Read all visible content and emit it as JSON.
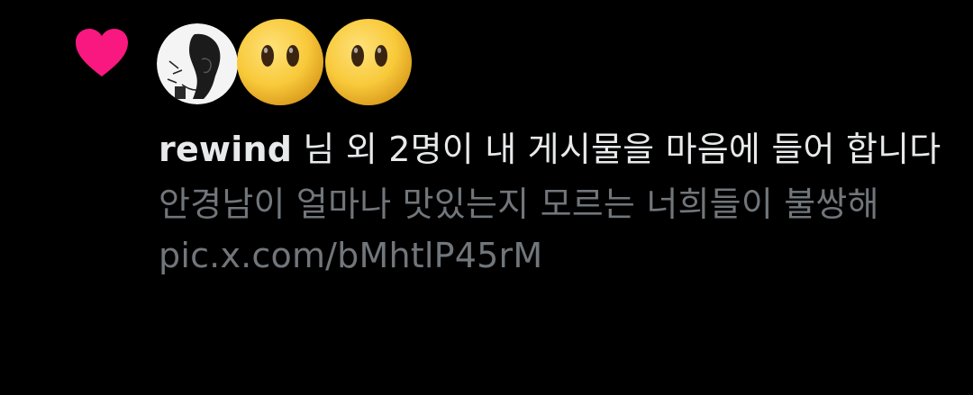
{
  "notification": {
    "type_icon": "heart-icon",
    "colors": {
      "heart": "#f91880",
      "primary_text": "#e7e9ea",
      "secondary_text": "#71767b",
      "background": "#000000"
    },
    "avatars": [
      {
        "icon": "user-sketch-avatar"
      },
      {
        "icon": "emoji-face-avatar"
      },
      {
        "icon": "emoji-face-avatar"
      }
    ],
    "username": "rewind",
    "message_text": " 님 외 2명이 내 게시물을 마음에 들어 합니다",
    "post_preview_text": "안경남이 얼마나 맛있는지 모르는 너희들이 불쌍해",
    "post_link": "pic.x.com/bMhtlP45rM"
  }
}
